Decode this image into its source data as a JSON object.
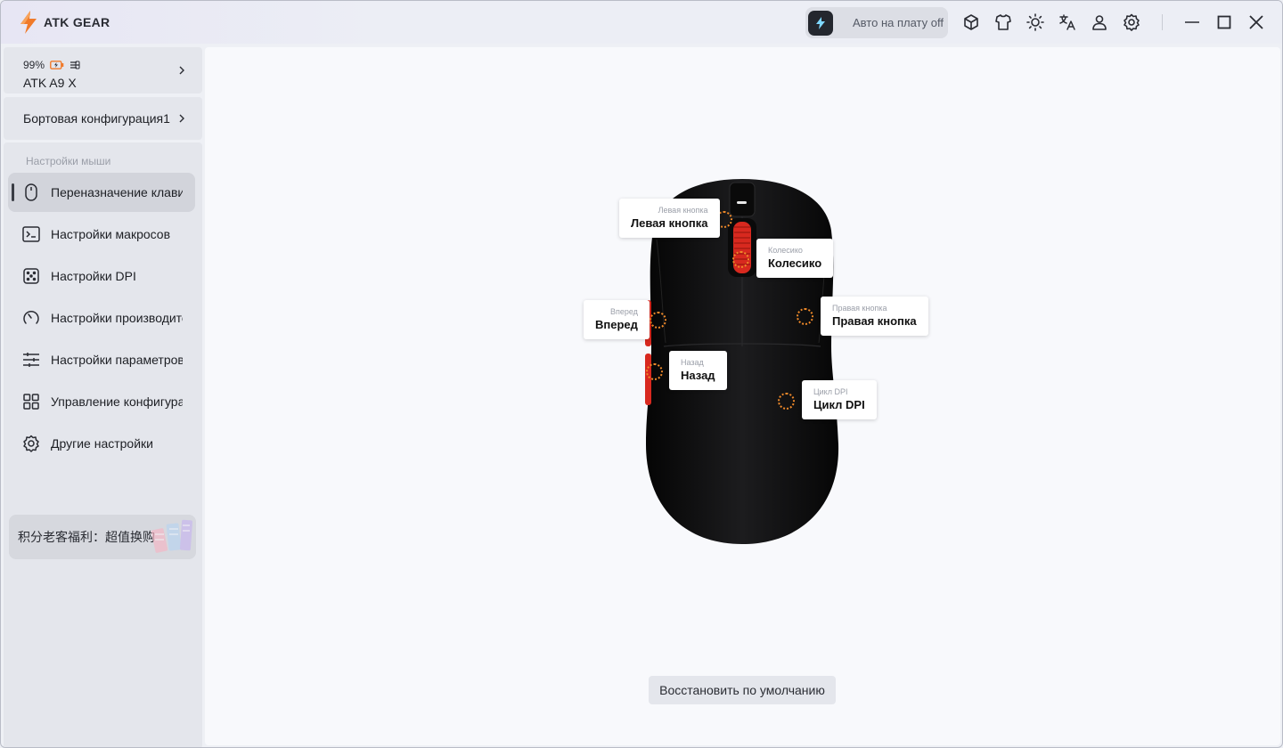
{
  "app": {
    "logo_text": "ATK GEAR",
    "accent_color": "#f07a2a"
  },
  "titlebar": {
    "auto_onboard_label": "Авто на плату off",
    "icons": [
      "cube-icon",
      "shirt-icon",
      "sun-icon",
      "translate-icon",
      "user-icon",
      "gear-icon"
    ],
    "window_controls": [
      "minimize-icon",
      "maximize-icon",
      "close-icon"
    ]
  },
  "device": {
    "battery": "99%",
    "name": "ATK A9 X"
  },
  "config": {
    "label": "Бортовая конфигурация1"
  },
  "sidebar": {
    "section_header": "Настройки мыши",
    "items": [
      {
        "label": "Переназначение клавиш",
        "icon": "mouse-icon",
        "active": true
      },
      {
        "label": "Настройки макросов",
        "icon": "terminal-icon",
        "active": false
      },
      {
        "label": "Настройки DPI",
        "icon": "dice-icon",
        "active": false
      },
      {
        "label": "Настройки производительности",
        "icon": "gauge-icon",
        "active": false
      },
      {
        "label": "Настройки параметров",
        "icon": "sliders-icon",
        "active": false
      },
      {
        "label": "Управление конфигурациями",
        "icon": "grid-icon",
        "active": false
      },
      {
        "label": "Другие настройки",
        "icon": "gear-icon",
        "active": false
      }
    ],
    "promo_text": "积分老客福利：超值换购"
  },
  "mouse_buttons": {
    "left": {
      "caption": "Левая кнопка",
      "value": "Левая кнопка"
    },
    "wheel": {
      "caption": "Колесико",
      "value": "Колесико"
    },
    "forward": {
      "caption": "Вперед",
      "value": "Вперед"
    },
    "right": {
      "caption": "Правая кнопка",
      "value": "Правая кнопка"
    },
    "back": {
      "caption": "Назад",
      "value": "Назад"
    },
    "dpi": {
      "caption": "Цикл DPI",
      "value": "Цикл DPI"
    }
  },
  "actions": {
    "reset_label": "Восстановить по умолчанию"
  }
}
